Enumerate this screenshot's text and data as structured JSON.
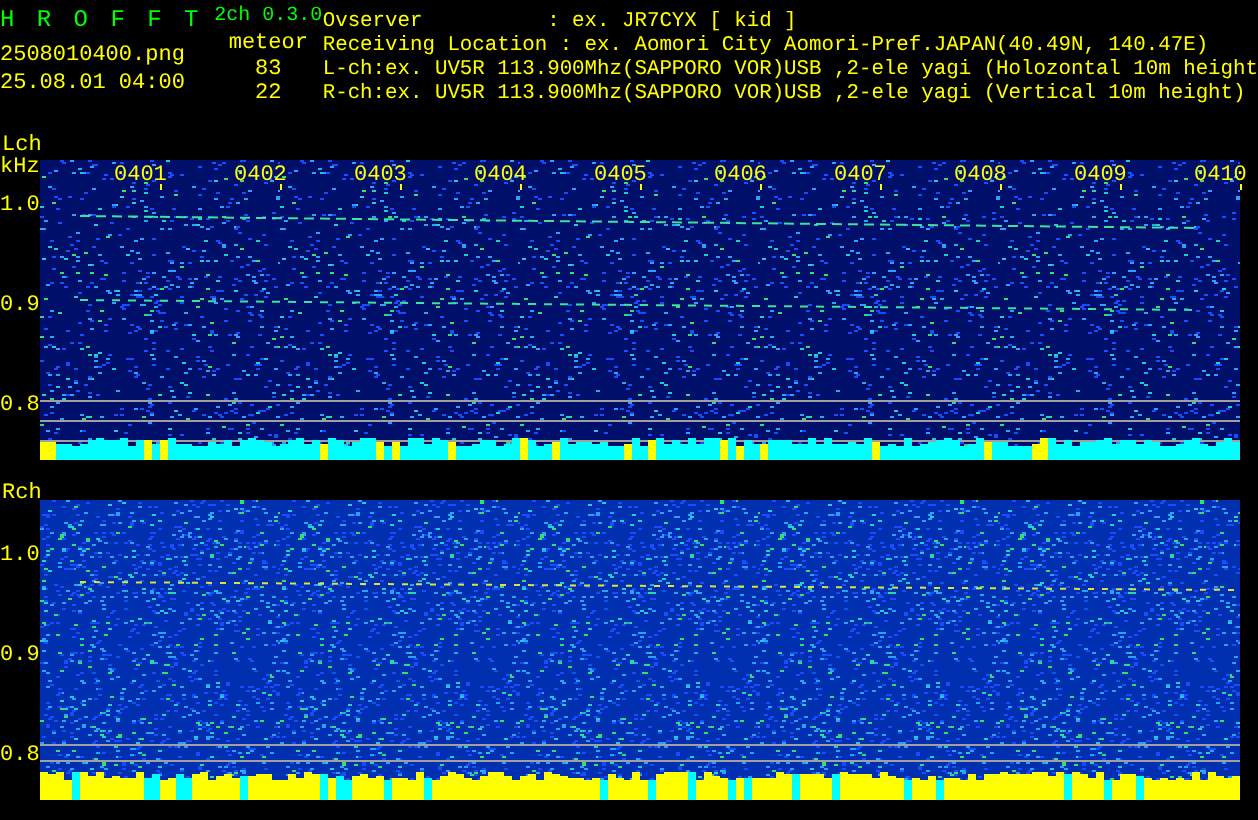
{
  "header": {
    "app_title": "H R O F F T",
    "version": "2ch 0.3.0",
    "file_name": "2508010400.png",
    "date_time": "25.08.01 04:00",
    "mode": "meteor",
    "counts": [
      "83",
      "22"
    ],
    "info_lines": [
      "Ovserver          : ex. JR7CYX [ kid ]",
      "Receiving Location : ex. Aomori City Aomori-Pref.JAPAN(40.49N, 140.47E)",
      "L-ch:ex. UV5R 113.900Mhz(SAPPORO VOR)USB ,2-ele yagi (Holozontal 10m height",
      "R-ch:ex. UV5R 113.900Mhz(SAPPORO VOR)USB ,2-ele yagi (Vertical 10m height)"
    ]
  },
  "channels": [
    {
      "label": "Lch",
      "unit": "kHz",
      "y_labels": [
        "1.0",
        "0.9",
        "0.8"
      ],
      "time_labels": [
        "0401",
        "0402",
        "0403",
        "0404",
        "0405",
        "0406",
        "0407",
        "0408",
        "0409",
        "0410"
      ]
    },
    {
      "label": "Rch",
      "y_labels": [
        "1.0",
        "0.9",
        "0.8"
      ]
    }
  ]
}
